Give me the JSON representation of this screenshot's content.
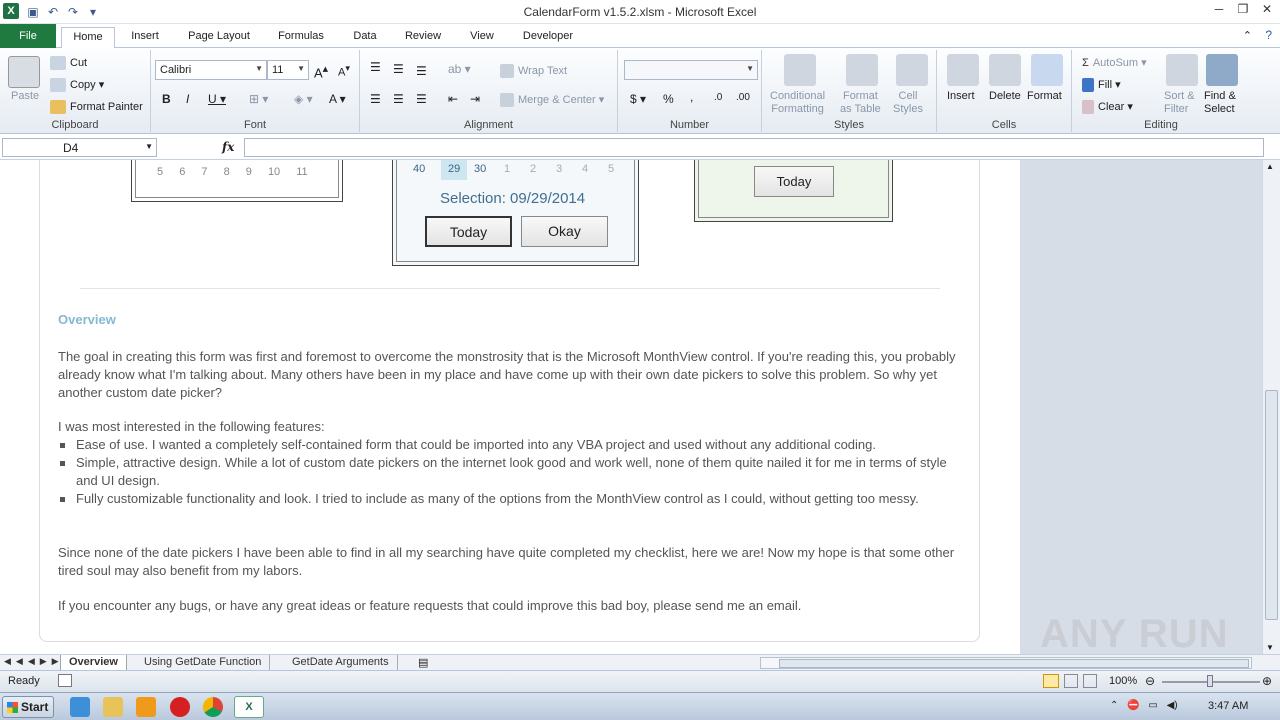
{
  "window": {
    "title": "CalendarForm v1.5.2.xlsm - Microsoft Excel"
  },
  "tabs": [
    "File",
    "Home",
    "Insert",
    "Page Layout",
    "Formulas",
    "Data",
    "Review",
    "View",
    "Developer"
  ],
  "ribbon": {
    "clipboard": {
      "paste": "Paste",
      "cut": "Cut",
      "copy": "Copy",
      "format_painter": "Format Painter",
      "label": "Clipboard"
    },
    "font": {
      "name": "Calibri",
      "size": "11",
      "label": "Font"
    },
    "alignment": {
      "wrap": "Wrap Text",
      "merge": "Merge & Center",
      "label": "Alignment"
    },
    "number": {
      "format": "",
      "label": "Number",
      "dollar": "$",
      "percent": "%",
      "comma": ","
    },
    "styles": {
      "conditional1": "Conditional",
      "conditional2": "Formatting",
      "table1": "Format",
      "table2": "as Table",
      "cell1": "Cell",
      "cell2": "Styles",
      "label": "Styles"
    },
    "cells": {
      "insert": "Insert",
      "delete": "Delete",
      "format": "Format",
      "label": "Cells"
    },
    "editing": {
      "autosum": "AutoSum",
      "fill": "Fill",
      "clear": "Clear",
      "sort1": "Sort &",
      "sort2": "Filter",
      "find1": "Find &",
      "find2": "Select",
      "label": "Editing"
    }
  },
  "formula_bar": {
    "name_box": "D4",
    "fx": "fx",
    "value": ""
  },
  "content": {
    "cal1_days": [
      "5",
      "6",
      "7",
      "8",
      "9",
      "10",
      "11"
    ],
    "cal2_week": "40",
    "cal2_days": [
      "29",
      "30",
      "1",
      "2",
      "3",
      "4",
      "5"
    ],
    "selection": "Selection: 09/29/2014",
    "today_btn": "Today",
    "okay_btn": "Okay",
    "today_btn2": "Today",
    "heading": "Overview",
    "p1": "The goal in creating this form was first and foremost to overcome the monstrosity that is the Microsoft MonthView control. If you're reading this, you probably already know what I'm talking about. Many others have been in my place and have come up with their own date pickers to solve this problem. So why yet another custom date picker?",
    "p2": "I was most interested in the following features:",
    "bullets": [
      "Ease of use. I wanted a completely self-contained form that could be imported into any VBA project and used without any additional coding.",
      "Simple, attractive design. While a lot of custom date pickers on the internet look good and work well, none of them quite nailed it for me in terms of style and UI design.",
      "Fully customizable functionality and look. I tried to include as many of the options from the MonthView control as I could, without getting too messy."
    ],
    "p3": "Since none of the date pickers I have been able to find in all my searching have quite completed my checklist, here we are! Now my hope is that some other tired soul may also benefit from my labors.",
    "p4": "If you encounter any bugs, or have any great ideas or feature requests that could improve this bad boy, please send me an email."
  },
  "sheet_tabs": [
    "Overview",
    "Using GetDate Function",
    "GetDate Arguments"
  ],
  "status": {
    "ready": "Ready",
    "zoom": "100%"
  },
  "taskbar": {
    "start": "Start",
    "clock": "3:47 AM"
  },
  "watermark": "ANY RUN"
}
